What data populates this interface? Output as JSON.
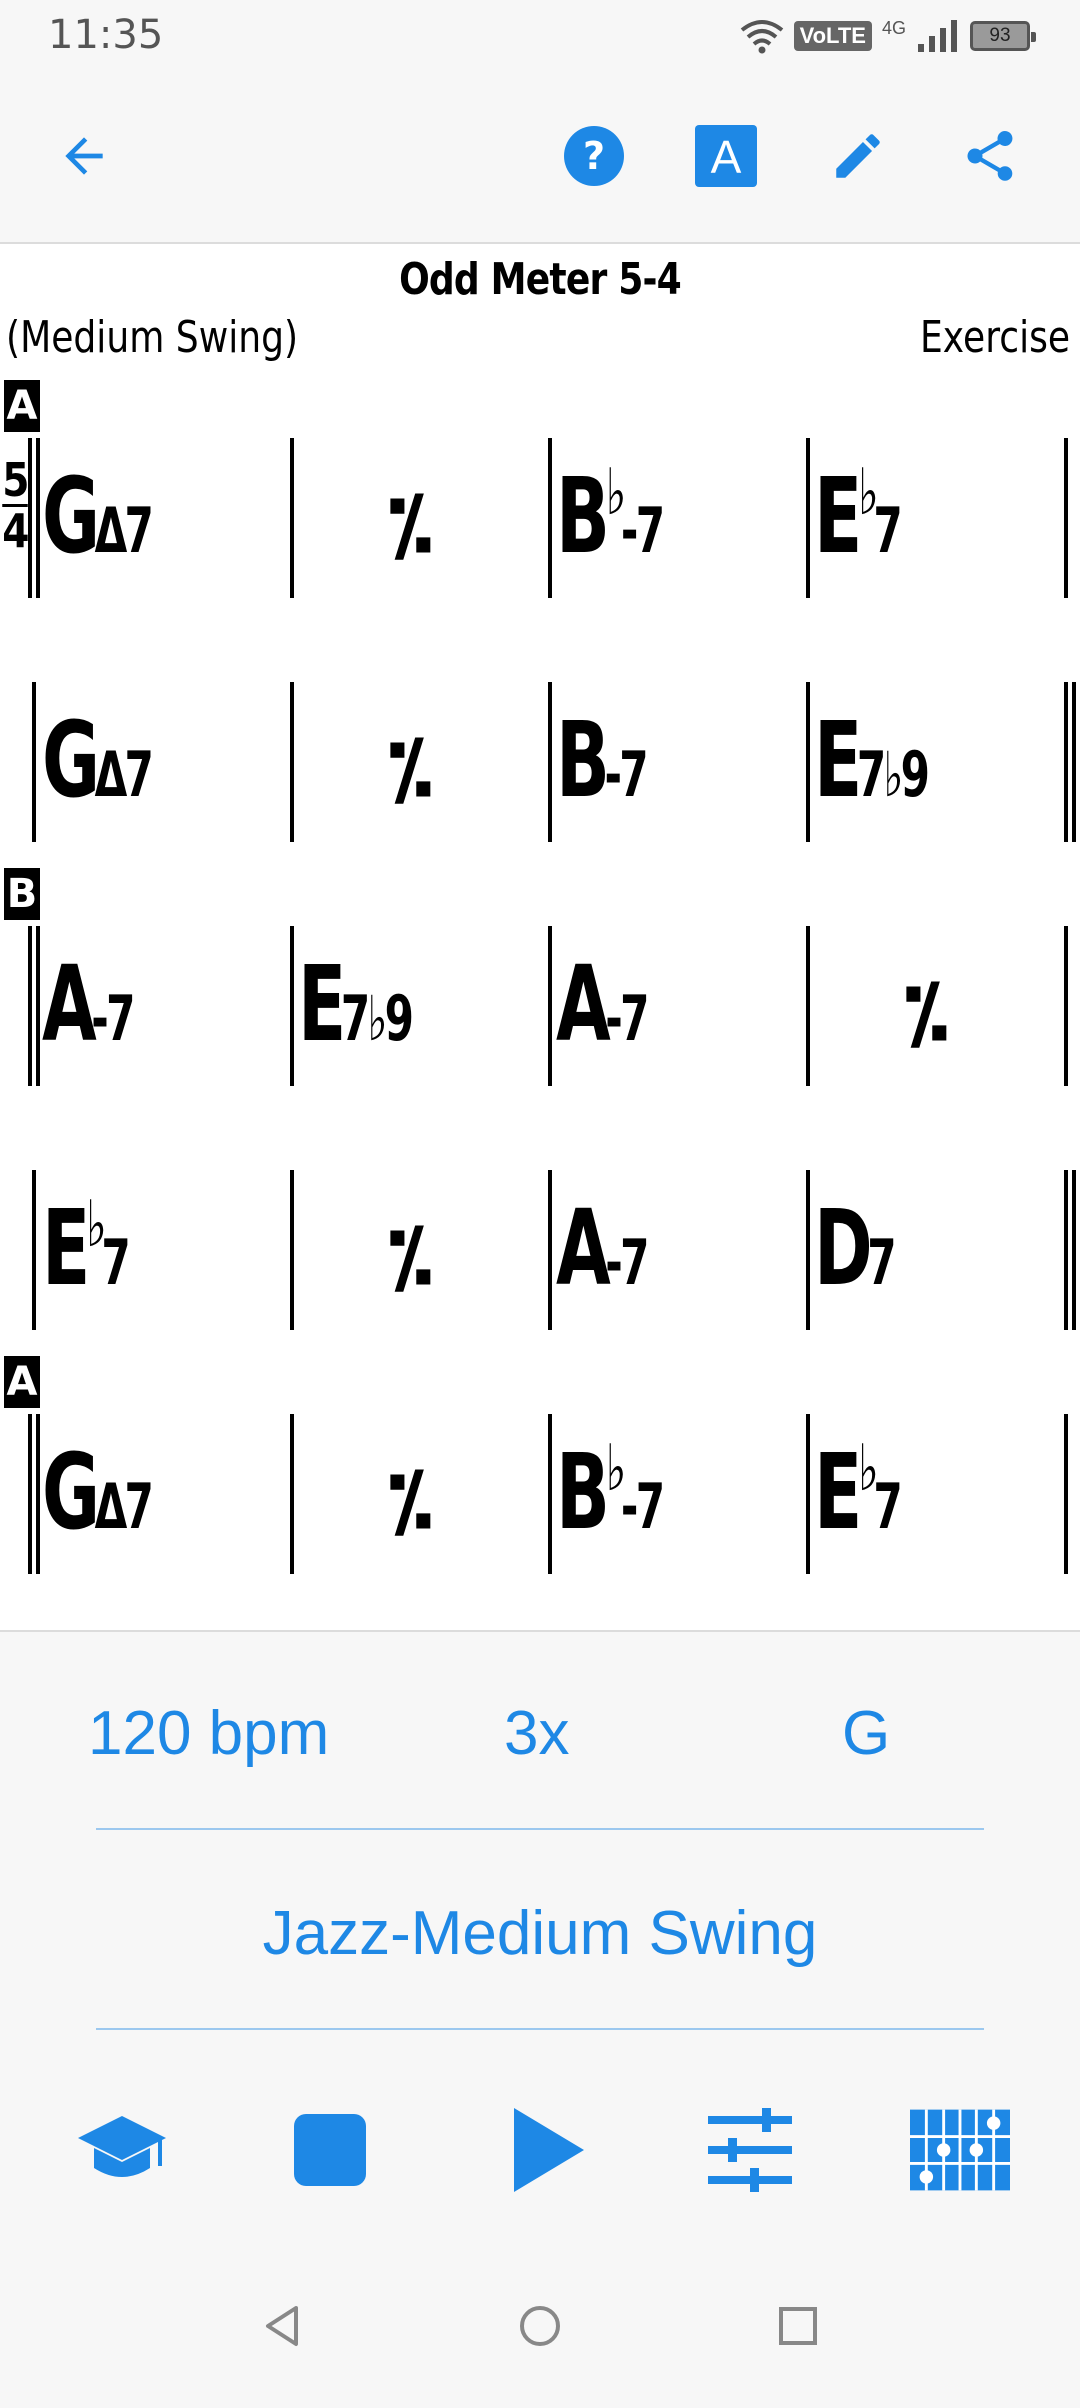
{
  "status_bar": {
    "time": "11:35",
    "volte": "VoLTE",
    "network": "4G",
    "battery": "93"
  },
  "app_bar": {
    "icons": [
      "back-arrow-icon",
      "help-icon",
      "font-a-icon",
      "edit-pencil-icon",
      "share-icon"
    ],
    "font_button_label": "A"
  },
  "chart": {
    "title": "Odd Meter 5-4",
    "style": "(Medium Swing)",
    "composer": "Exercise",
    "time_signature": {
      "top": "5",
      "bottom": "4"
    },
    "rows": [
      {
        "section": "A",
        "bars": [
          {
            "root": "G",
            "quality": "Δ7"
          },
          {
            "repeat": "⁄"
          },
          {
            "root": "B",
            "accidental": "♭",
            "quality": "-7"
          },
          {
            "root": "E",
            "accidental": "♭",
            "quality": "7"
          }
        ]
      },
      {
        "section": "",
        "bars": [
          {
            "root": "G",
            "quality": "Δ7"
          },
          {
            "repeat": "⁄"
          },
          {
            "root": "B",
            "quality": "-7"
          },
          {
            "root": "E",
            "quality": "7♭9"
          }
        ]
      },
      {
        "section": "B",
        "bars": [
          {
            "root": "A",
            "quality": "-7"
          },
          {
            "root": "E",
            "quality": "7♭9"
          },
          {
            "root": "A",
            "quality": "-7"
          },
          {
            "repeat": "⁄"
          }
        ]
      },
      {
        "section": "",
        "bars": [
          {
            "root": "E",
            "accidental": "♭",
            "quality": "7"
          },
          {
            "repeat": "⁄"
          },
          {
            "root": "A",
            "quality": "-7"
          },
          {
            "root": "D",
            "quality": "7"
          }
        ]
      },
      {
        "section": "A",
        "bars": [
          {
            "root": "G",
            "quality": "Δ7"
          },
          {
            "repeat": "⁄"
          },
          {
            "root": "B",
            "accidental": "♭",
            "quality": "-7"
          },
          {
            "root": "E",
            "accidental": "♭",
            "quality": "7"
          }
        ]
      }
    ]
  },
  "controls": {
    "tempo": "120 bpm",
    "repeats": "3x",
    "key": "G",
    "style": "Jazz-Medium Swing"
  },
  "toolbar": {
    "icons": [
      "graduation-cap-icon",
      "stop-icon",
      "play-icon",
      "mixer-sliders-icon",
      "drum-grid-icon"
    ]
  },
  "colors": {
    "accent": "#1e88e5",
    "divider": "#9cc8ef",
    "background": "#f7f7f7",
    "sheet": "#ffffff"
  }
}
